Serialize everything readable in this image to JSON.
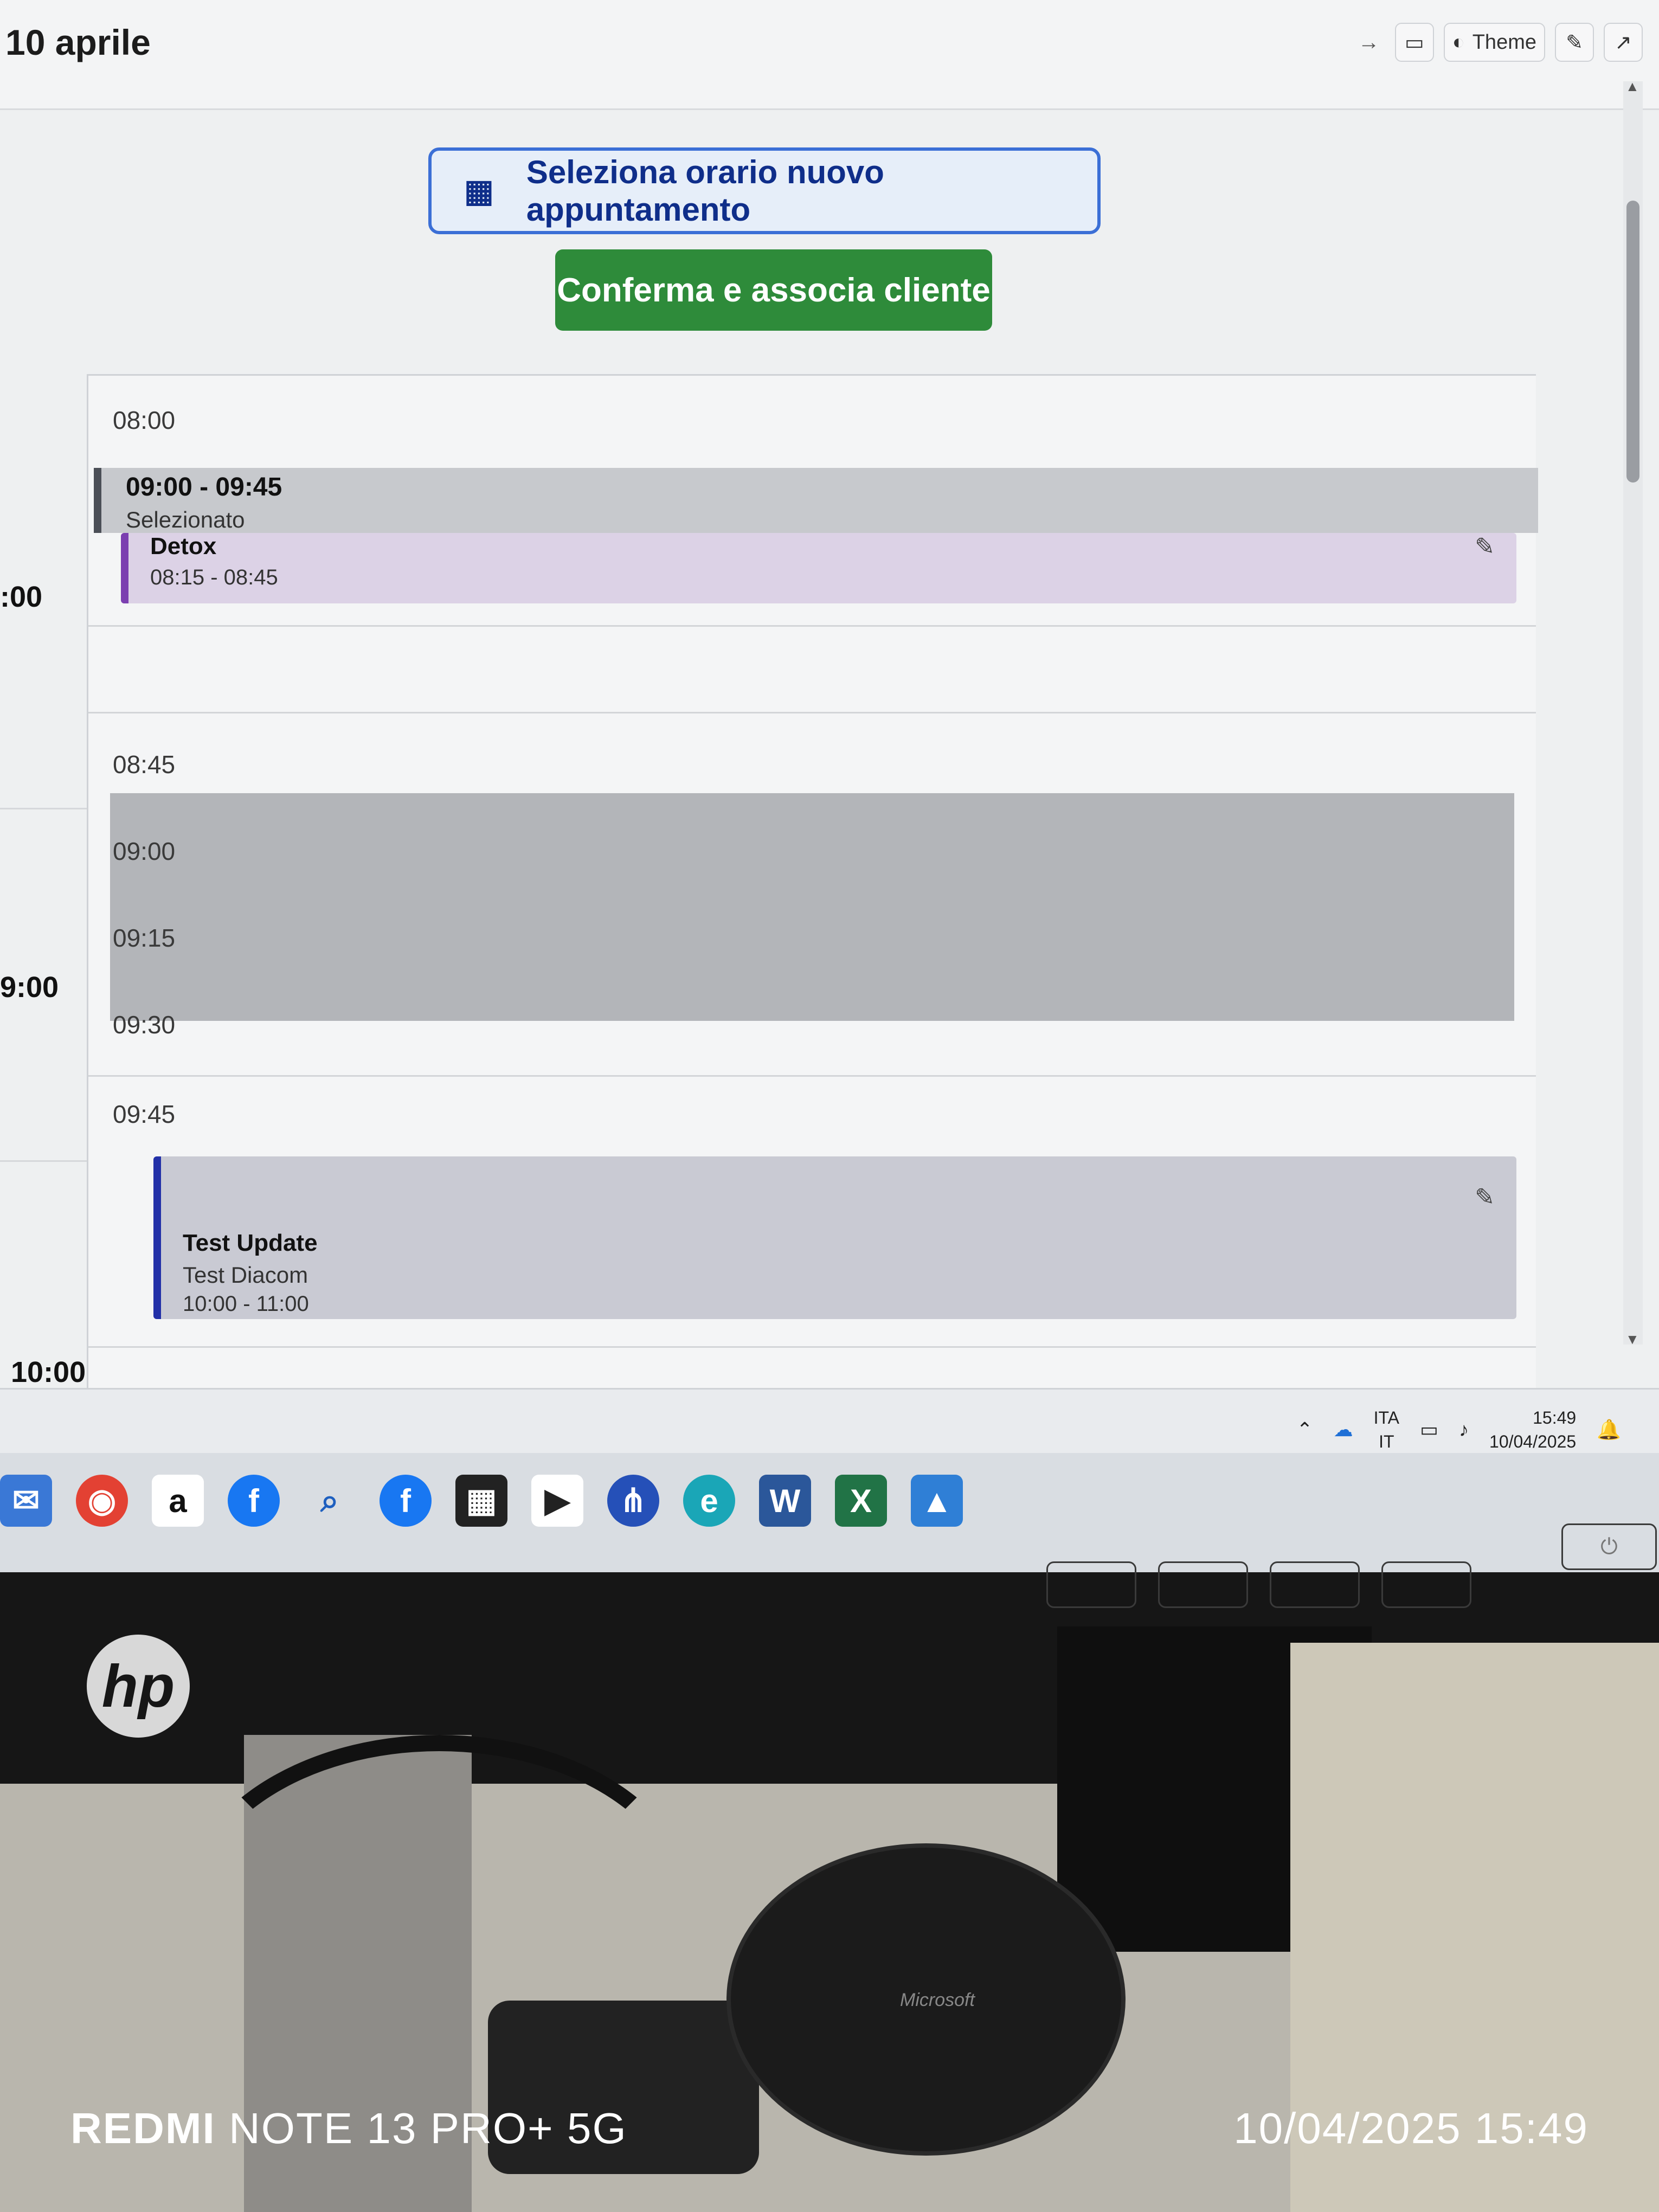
{
  "header": {
    "date_title": "10 aprile",
    "theme_label": "Theme"
  },
  "actions": {
    "select_time_label": "Seleziona orario nuovo appuntamento",
    "confirm_label": "Conferma e associa cliente"
  },
  "calendar": {
    "hour_labels": [
      ":00",
      "9:00",
      "10:00"
    ],
    "slot_labels": [
      "08:00",
      "08:45",
      "09:00",
      "09:15",
      "09:30",
      "09:45"
    ],
    "selection": {
      "time": "09:00 - 09:45",
      "status": "Selezionato"
    },
    "appointments": [
      {
        "title": "Detox",
        "subtitle": "",
        "time": "08:15 - 08:45",
        "color": "#7b3fb0"
      },
      {
        "title": "Test Update",
        "subtitle": "Test Diacom",
        "time": "10:00 - 11:00",
        "color": "#2230a8"
      }
    ]
  },
  "system_tray": {
    "language": "ITA",
    "keyboard": "IT",
    "time": "15:49",
    "date": "10/04/2025"
  },
  "photo_watermark": {
    "device_brand": "REDMI",
    "device_model": "NOTE 13 PRO+ 5G",
    "timestamp": "10/04/2025 15:49"
  },
  "monitor": {
    "logo": "hp",
    "mouse_brand": "Microsoft"
  }
}
